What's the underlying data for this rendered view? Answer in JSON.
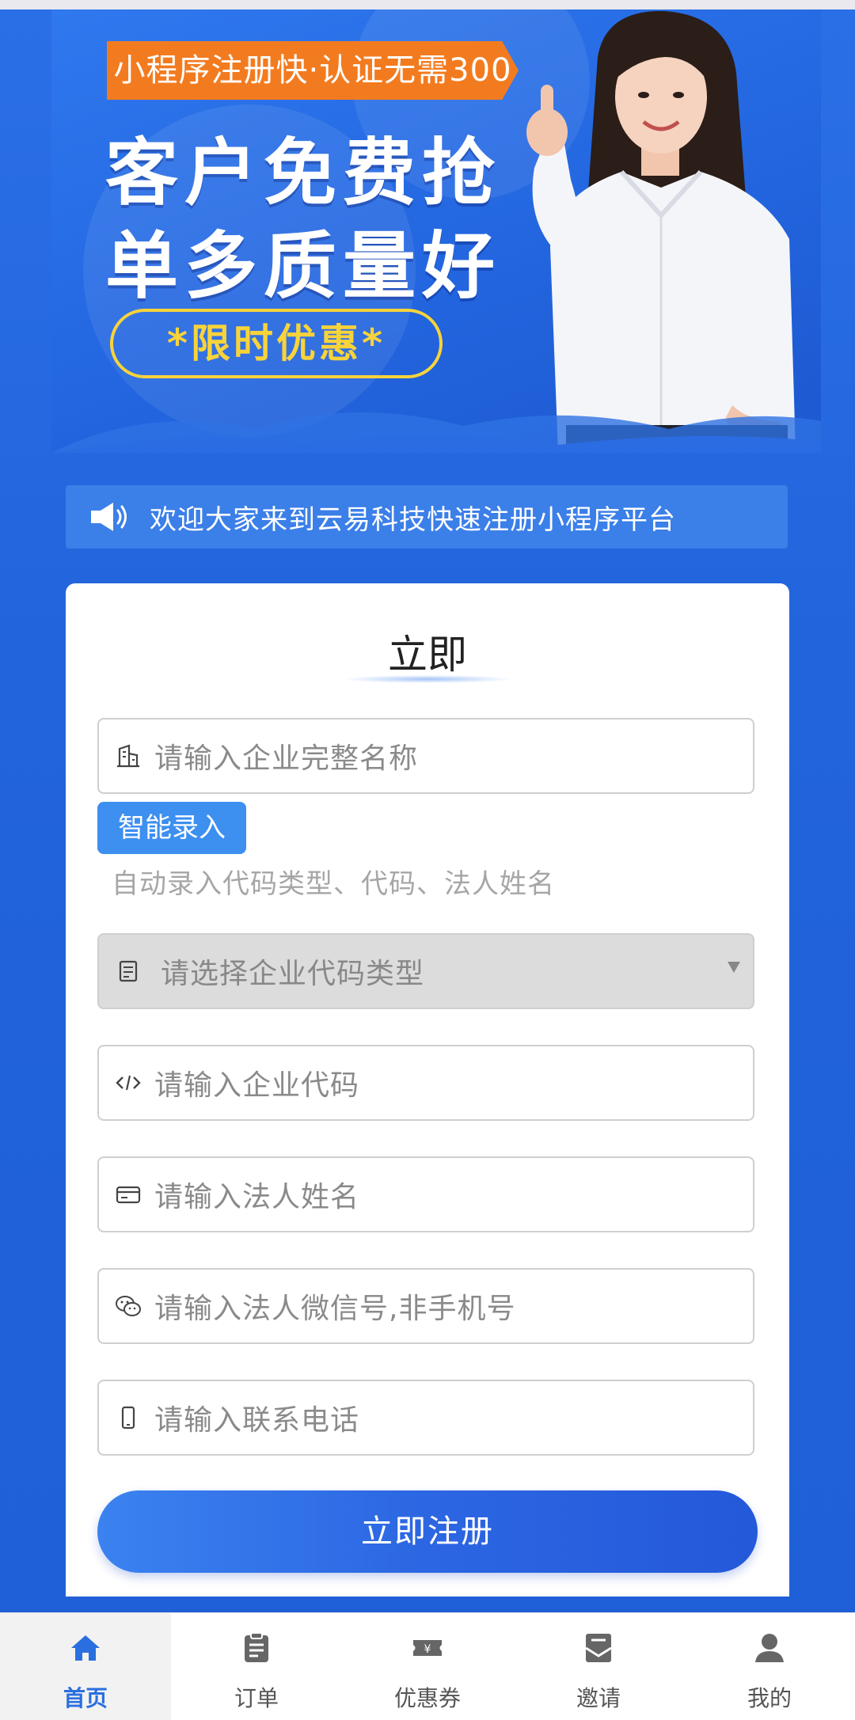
{
  "banner": {
    "promo_tag": "小程序注册快·认证无需300",
    "headline_line1": "客户免费抢",
    "headline_line2": "单多质量好",
    "badge": "*限时优惠*"
  },
  "notice": {
    "icon": "speaker-icon",
    "text": "欢迎大家来到云易科技快速注册小程序平台"
  },
  "form": {
    "title": "立即",
    "company_name": {
      "icon": "building-icon",
      "placeholder": "请输入企业完整名称"
    },
    "smart_entry": {
      "button_label": "智能录入",
      "hint": "自动录入代码类型、代码、法人姓名"
    },
    "code_type": {
      "icon": "document-icon",
      "placeholder": "请选择企业代码类型"
    },
    "company_code": {
      "icon": "code-icon",
      "placeholder": "请输入企业代码"
    },
    "legal_person": {
      "icon": "id-card-icon",
      "placeholder": "请输入法人姓名"
    },
    "wechat": {
      "icon": "wechat-icon",
      "placeholder": "请输入法人微信号,非手机号"
    },
    "phone": {
      "icon": "phone-icon",
      "placeholder": "请输入联系电话"
    },
    "submit_label": "立即注册"
  },
  "tabbar": {
    "items": [
      {
        "label": "首页",
        "icon": "home-icon",
        "active": true
      },
      {
        "label": "订单",
        "icon": "clipboard-icon",
        "active": false
      },
      {
        "label": "优惠券",
        "icon": "coupon-icon",
        "active": false
      },
      {
        "label": "邀请",
        "icon": "invite-icon",
        "active": false
      },
      {
        "label": "我的",
        "icon": "user-icon",
        "active": false
      }
    ]
  },
  "colors": {
    "background": "#2264dc",
    "accent": "#2a6fe0",
    "promo_orange": "#f37b1f",
    "badge_yellow": "#f8d33a"
  }
}
